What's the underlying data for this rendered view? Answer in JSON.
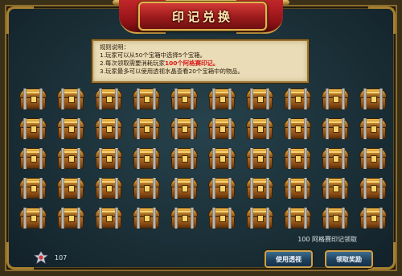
{
  "title": "印记兑换",
  "rules": {
    "heading": "规则说明：",
    "line1": "1.玩家可以从50个宝箱中选择5个宝箱。",
    "line2_pre": "2.每次领取需要消耗玩家",
    "line2_highlight": "100个阿格赛印记。",
    "line3": "3.玩家最多可以使用透视水晶查看20个宝箱中的物品。"
  },
  "chest_rows": 5,
  "chest_cols": 10,
  "seal_requirement": "100 阿格赛印记领取",
  "player_count": "107",
  "buttons": {
    "use_perspective": "使用透视",
    "claim_reward": "领取奖励"
  },
  "colors": {
    "highlight": "#d8191a",
    "button_border": "#c9a24e",
    "panel_bg": "#1b3038"
  },
  "icons": {
    "chest": "treasure-chest-icon",
    "seal": "seal-emblem-icon"
  }
}
